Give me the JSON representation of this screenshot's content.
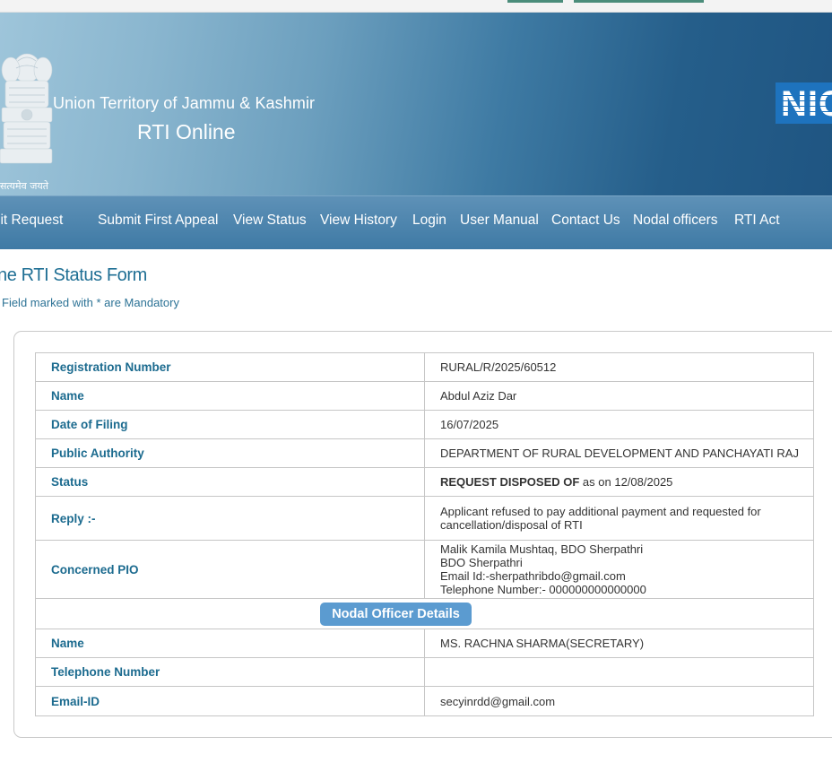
{
  "header": {
    "emblem_text": "सत्यमेव जयते",
    "ut_title": "Union Territory of Jammu & Kashmir",
    "app_title": "RTI Online",
    "nic_logo": "NIC"
  },
  "nav": {
    "items": [
      "Submit Request",
      "Submit First Appeal",
      "View Status",
      "View History",
      "Login",
      "User Manual",
      "Contact Us",
      "Nodal officers",
      "RTI Act"
    ]
  },
  "form": {
    "title": "Online RTI Status Form",
    "mandatory_note": "Field marked with * are Mandatory"
  },
  "status_table": {
    "registration_label": "Registration Number",
    "registration_value": "RURAL/R/2025/60512",
    "name_label": "Name",
    "name_value": "Abdul Aziz Dar",
    "date_label": "Date of Filing",
    "date_value": "16/07/2025",
    "authority_label": "Public Authority",
    "authority_value": "DEPARTMENT OF RURAL DEVELOPMENT AND PANCHAYATI RAJ",
    "status_label": "Status",
    "status_value": "REQUEST DISPOSED OF",
    "status_suffix": " as on 12/08/2025",
    "reply_label": "Reply :-",
    "reply_value": "Applicant refused to pay additional payment and requested for cancellation/disposal of RTI",
    "pio_label": "Concerned PIO",
    "pio_lines": [
      "Malik Kamila Mushtaq, BDO Sherpathri",
      "BDO Sherpathri",
      "Email Id:-sherpathribdo@gmail.com",
      "Telephone Number:- 000000000000000"
    ],
    "nodal_button": "Nodal Officer Details",
    "nodal_name_label": "Name",
    "nodal_name_value": "MS. RACHNA SHARMA(SECRETARY)",
    "nodal_phone_label": "Telephone Number",
    "nodal_phone_value": "",
    "nodal_email_label": "Email-ID",
    "nodal_email_value": "secyinrdd@gmail.com"
  }
}
